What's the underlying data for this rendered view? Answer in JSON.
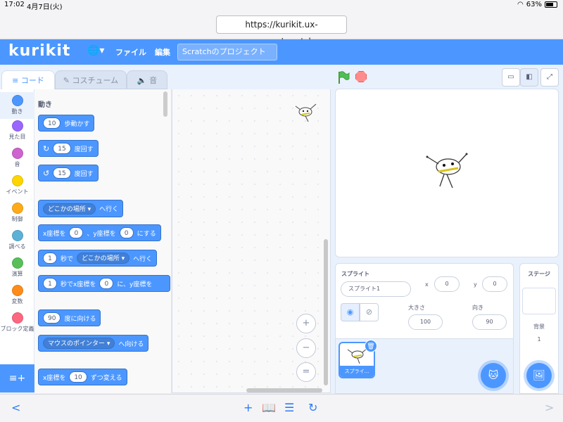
{
  "status_bar": {
    "time": "17:02",
    "date": "4月7日(火)",
    "battery": "63%"
  },
  "browser": {
    "url": "https://kurikit.ux-xu.com/scratch"
  },
  "menu": {
    "logo": "kurikit",
    "file": "ファイル",
    "edit": "編集",
    "project_title": "Scratchのプロジェクト"
  },
  "tabs": {
    "code": "コード",
    "costume": "コスチューム",
    "sound": "音"
  },
  "categories": [
    {
      "label": "動き",
      "color": "#4c97ff"
    },
    {
      "label": "見た目",
      "color": "#9966ff"
    },
    {
      "label": "音",
      "color": "#cf63cf"
    },
    {
      "label": "イベント",
      "color": "#ffd500"
    },
    {
      "label": "制御",
      "color": "#ffab19"
    },
    {
      "label": "調べる",
      "color": "#5cb1d6"
    },
    {
      "label": "演算",
      "color": "#59c059"
    },
    {
      "label": "変数",
      "color": "#ff8c1a"
    },
    {
      "label": "ブロック定義",
      "color": "#ff6680"
    }
  ],
  "palette": {
    "title": "動き",
    "move": {
      "value": "10",
      "text": "歩動かす"
    },
    "turn_right": {
      "value": "15",
      "text": "度回す"
    },
    "turn_left": {
      "value": "15",
      "text": "度回す"
    },
    "goto": {
      "menu": "どこかの場所",
      "text": "へ行く"
    },
    "goto_xy": {
      "pre": "x座標を",
      "x": "0",
      "mid": "、y座標を",
      "y": "0",
      "post": "にする"
    },
    "glide": {
      "value": "1",
      "pre": "秒で",
      "menu": "どこかの場所",
      "post": "へ行く"
    },
    "glide_xy": {
      "value": "1",
      "pre": "秒でx座標を",
      "x": "0",
      "mid": "に、y座標を"
    },
    "point_dir": {
      "value": "90",
      "text": "度に向ける"
    },
    "point_towards": {
      "menu": "マウスのポインター",
      "text": "へ向ける"
    },
    "change_x": {
      "pre": "x座標を",
      "value": "10",
      "post": "ずつ変える"
    }
  },
  "zoom": {
    "in": "+",
    "out": "−",
    "reset": "="
  },
  "sprite_info": {
    "sprite_label": "スプライト",
    "sprite_name": "スプライト1",
    "x_label": "x",
    "x": "0",
    "y_label": "y",
    "y": "0",
    "size_label": "大きさ",
    "size": "100",
    "direction_label": "向き",
    "direction": "90"
  },
  "sprite_tile": {
    "name": "スプライ..."
  },
  "stage_pane": {
    "title": "ステージ",
    "backdrop_label": "背景",
    "backdrop_count": "1"
  },
  "bottom_bar": {
    "back": "<",
    "forward": ">"
  }
}
